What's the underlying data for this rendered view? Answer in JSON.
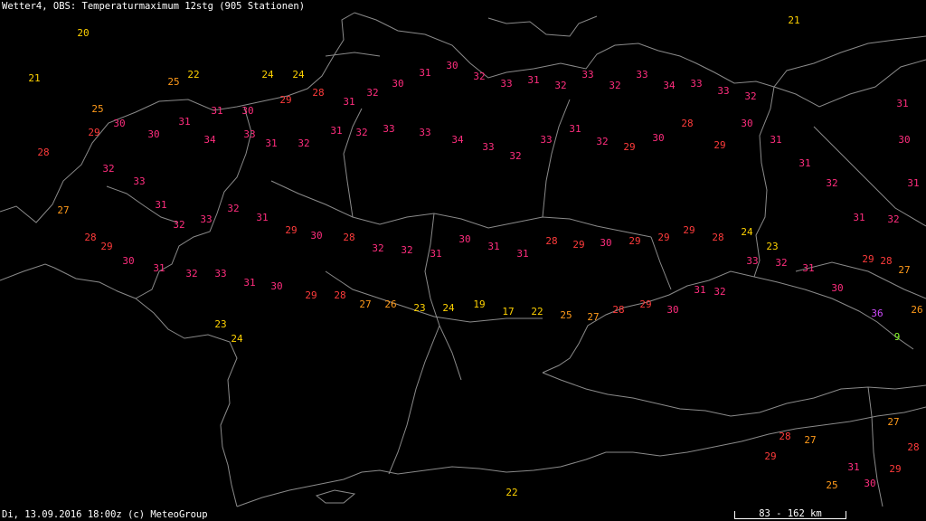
{
  "header": {
    "title": "Wetter4, OBS: Temperaturmaximum 12stg (905 Stationen)"
  },
  "footer": {
    "timestamp": "Di, 13.09.2016 18:00z (c) MeteoGroup"
  },
  "scale": {
    "label": "83 - 162 km"
  },
  "colors": {
    "background": "#000000",
    "border": "#8a8a8a",
    "text": "#ffffff",
    "temp_19_24": "#ffd200",
    "temp_25_27": "#ff9a1a",
    "temp_28_29": "#ff3b3b",
    "temp_30_34": "#ff2d7d",
    "temp_35_36": "#d14cff",
    "temp_low": "#8aff2a"
  },
  "chart_data": {
    "type": "station_map",
    "variable": "Temperaturmaximum 12stg",
    "values_shown": [
      "20",
      "21",
      "25",
      "22",
      "24",
      "24",
      "21",
      "29",
      "25",
      "28",
      "30",
      "30",
      "31",
      "31",
      "30",
      "29",
      "28",
      "31",
      "32",
      "30",
      "31",
      "30",
      "32",
      "33",
      "31",
      "32",
      "33",
      "32",
      "33",
      "34",
      "33",
      "33",
      "32",
      "34",
      "33",
      "31",
      "32",
      "31",
      "32",
      "33",
      "33",
      "34",
      "33",
      "32",
      "33",
      "31",
      "32",
      "29",
      "30",
      "28",
      "29",
      "30",
      "31",
      "31",
      "32",
      "31",
      "32",
      "31",
      "30",
      "31",
      "32",
      "33",
      "31",
      "32",
      "33",
      "32",
      "31",
      "29",
      "30",
      "28",
      "32",
      "32",
      "31",
      "30",
      "31",
      "31",
      "28",
      "29",
      "30",
      "29",
      "29",
      "29",
      "28",
      "24",
      "23",
      "27",
      "28",
      "29",
      "30",
      "31",
      "32",
      "33",
      "31",
      "30",
      "29",
      "28",
      "27",
      "26",
      "23",
      "24",
      "19",
      "17",
      "22",
      "25",
      "27",
      "28",
      "29",
      "30",
      "31",
      "32",
      "33",
      "32",
      "31",
      "30",
      "29",
      "28",
      "27",
      "26",
      "36",
      "9",
      "23",
      "24",
      "22",
      "25",
      "27",
      "28",
      "29",
      "31",
      "30",
      "29",
      "28",
      "27"
    ]
  }
}
